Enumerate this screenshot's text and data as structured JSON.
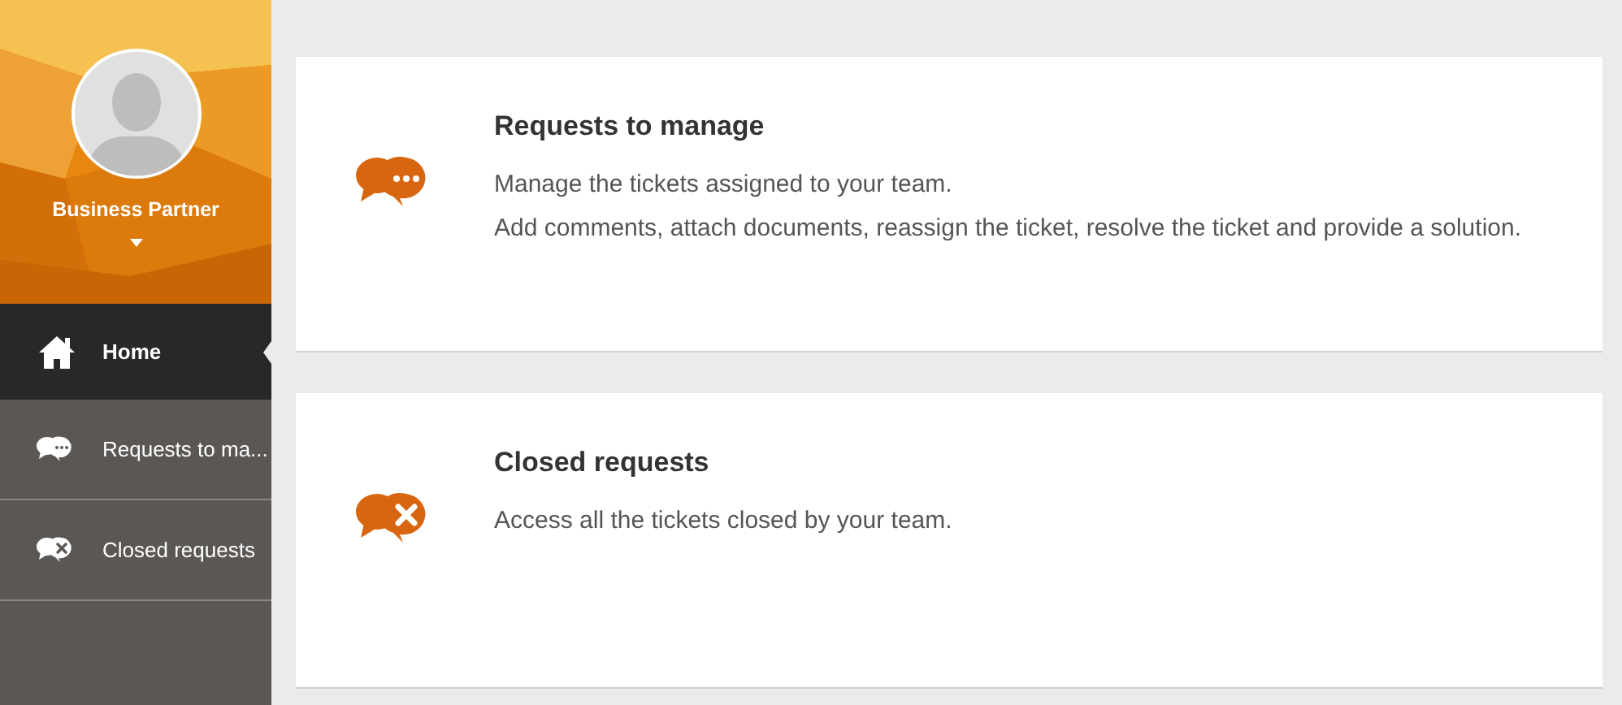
{
  "profile": {
    "name": "Business Partner"
  },
  "nav": [
    {
      "label": "Home",
      "kind": "home",
      "selected": true
    },
    {
      "label": "Requests to ma...",
      "kind": "chat-dots",
      "selected": false
    },
    {
      "label": "Closed requests",
      "kind": "chat-x",
      "selected": false
    }
  ],
  "cards": [
    {
      "title": "Requests to manage",
      "kind": "chat-dots",
      "lines": [
        "Manage the tickets assigned to your team.",
        "Add comments, attach documents, reassign the ticket, resolve the ticket and provide a solution."
      ]
    },
    {
      "title": "Closed requests",
      "kind": "chat-x",
      "lines": [
        "Access all the tickets closed by your team."
      ]
    }
  ]
}
